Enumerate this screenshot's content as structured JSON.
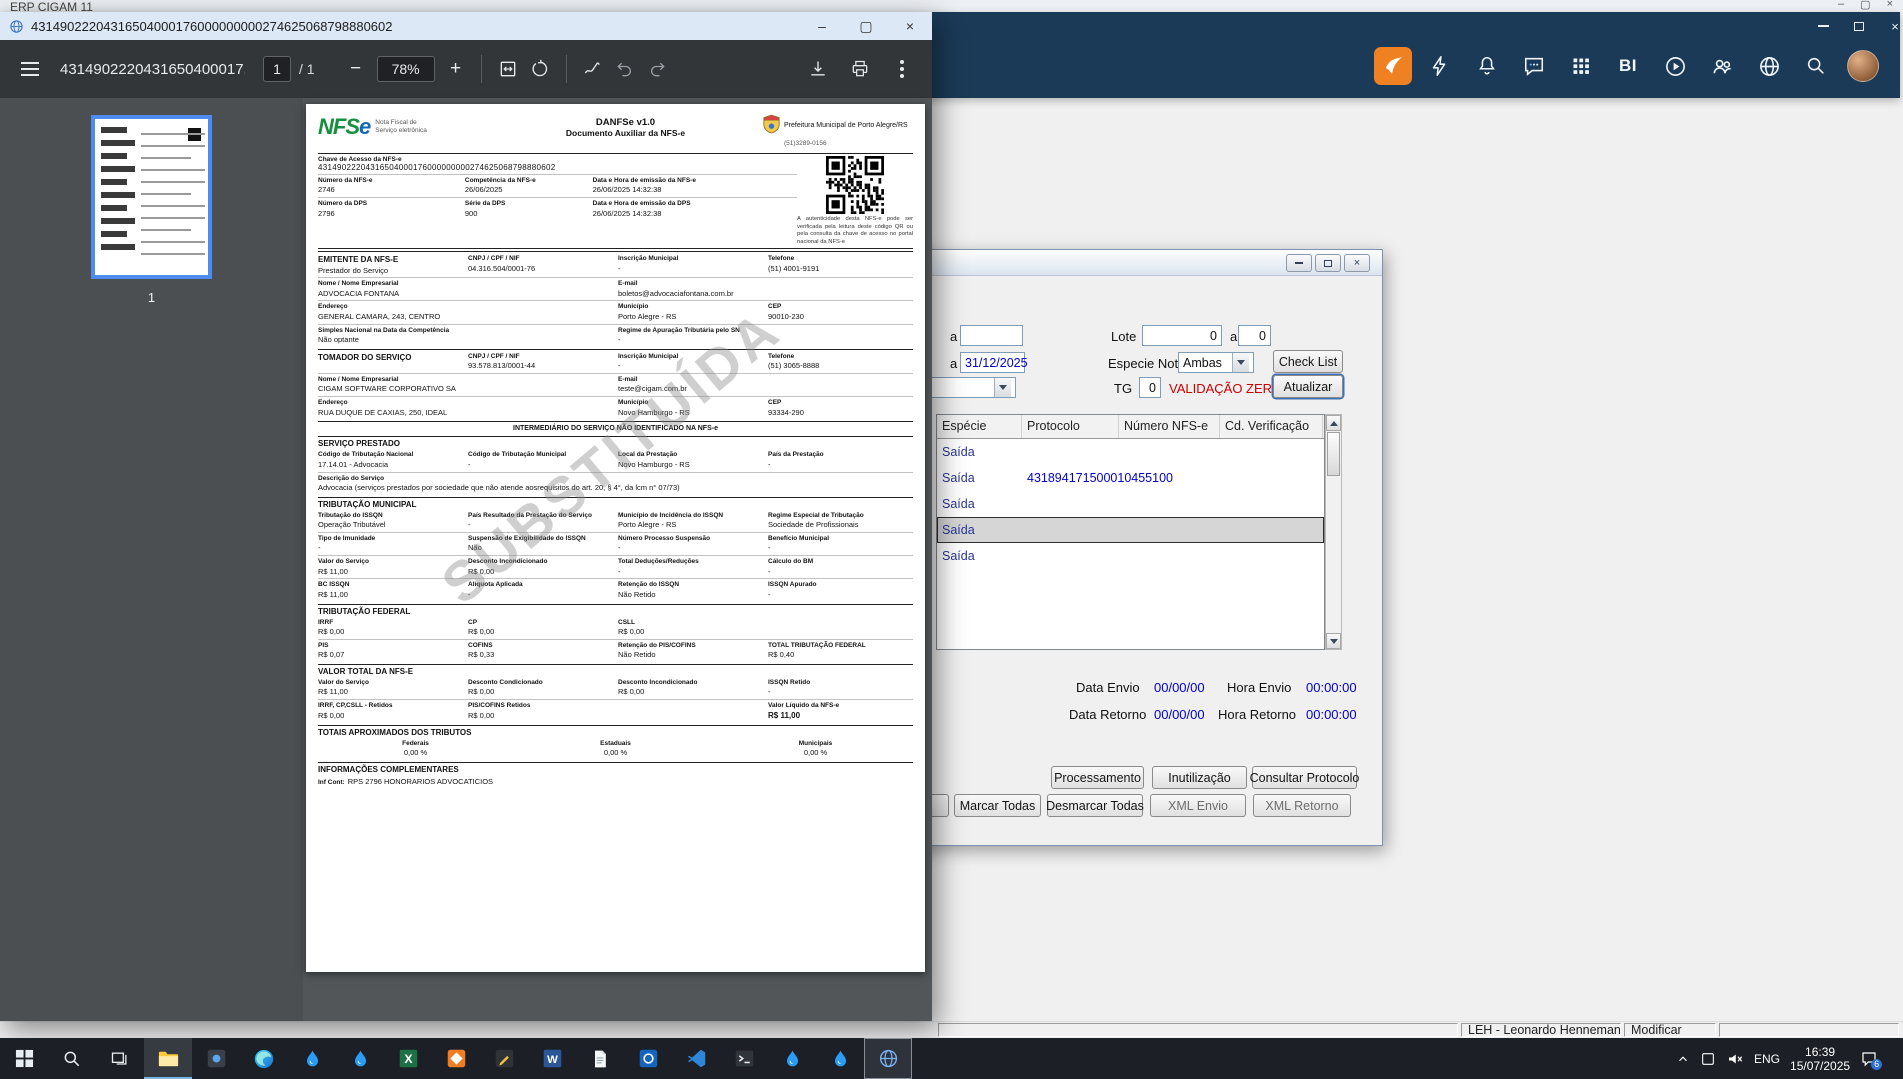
{
  "erp": {
    "title": "ERP CIGAM 11",
    "status_user": "LEH - Leonardo Hennemann",
    "status_mode": "Modificar"
  },
  "web_header": {
    "icons": [
      {
        "name": "cigam-logo-icon",
        "icon": "cigam"
      },
      {
        "name": "lightning-icon",
        "icon": "bolt"
      },
      {
        "name": "bell-icon",
        "icon": "bell"
      },
      {
        "name": "chat-icon",
        "icon": "chat"
      },
      {
        "name": "apps-grid-icon",
        "icon": "grid"
      },
      {
        "name": "bi-label",
        "text": "BI"
      },
      {
        "name": "play-icon",
        "icon": "play"
      },
      {
        "name": "people-icon",
        "icon": "people"
      },
      {
        "name": "globe-icon",
        "icon": "globeweb"
      },
      {
        "name": "search-icon",
        "icon": "searchw"
      },
      {
        "name": "user-avatar",
        "icon": "avatar"
      }
    ]
  },
  "pdf_window": {
    "title": "43149022204316504000176000000000274625068798880602",
    "toolbar": {
      "doc_title": "4314902220431650400017...",
      "page": "1",
      "page_total": "/ 1",
      "zoom": "78%"
    },
    "thumbnail_label": "1"
  },
  "doc": {
    "logo_nfs": "NFS",
    "logo_e": "e",
    "logo_sub1": "Nota Fiscal de",
    "logo_sub2": "Serviço eletrônica",
    "title": "DANFSe v1.0",
    "subtitle": "Documento Auxiliar da NFS-e",
    "city": "Prefeitura Municipal de Porto Alegre/RS",
    "city_phone": "(51)3289-0156",
    "access_key_label": "Chave de Acesso da NFS-e",
    "access_key": "43149022204316504000176000000000274625068798880602",
    "qr_caption": "A autenticidade desta NFS-e pode ser verificada pela leitura deste código QR ou pela consulta da chave de acesso no portal nacional da NFS-e",
    "watermark": "SUBSTITUÍDA",
    "meta_rows": [
      [
        {
          "l": "Número da NFS-e",
          "v": "2746"
        },
        {
          "l": "Competência da NFS-e",
          "v": "26/06/2025"
        },
        {
          "l": "Data e Hora de emissão da NFS-e",
          "v": "26/06/2025 14:32:38"
        }
      ],
      [
        {
          "l": "Número da DPS",
          "v": "2796"
        },
        {
          "l": "Série da DPS",
          "v": "900"
        },
        {
          "l": "Data e Hora de emissão da DPS",
          "v": "26/06/2025 14:32:38"
        }
      ]
    ],
    "sections": [
      {
        "rows": [
          [
            {
              "l": "EMITENTE DA NFS-E",
              "v": "Prestador do Serviço",
              "big": true
            },
            {
              "l": "CNPJ / CPF / NIF",
              "v": "04.316.504/0001-76"
            },
            {
              "l": "Inscrição Municipal",
              "v": "-"
            },
            {
              "l": "Telefone",
              "v": "(51) 4001-9191"
            }
          ],
          [
            {
              "l": "Nome / Nome Empresarial",
              "v": "ADVOCACIA FONTANA",
              "w": 6
            },
            {
              "l": "E-mail",
              "v": "boletos@advocaciafontana.com.br",
              "w": 6
            }
          ],
          [
            {
              "l": "Endereço",
              "v": "GENERAL CAMARA, 243, CENTRO",
              "w": 6
            },
            {
              "l": "Município",
              "v": "Porto Alegre - RS"
            },
            {
              "l": "CEP",
              "v": "90010-230"
            }
          ],
          [
            {
              "l": "Simples Nacional na Data da Competência",
              "v": "Não optante",
              "w": 6
            },
            {
              "l": "Regime de Apuração Tributária pelo SN",
              "v": "-",
              "w": 6
            }
          ]
        ]
      },
      {
        "rows": [
          [
            {
              "l": "TOMADOR DO SERVIÇO",
              "v": "",
              "big": true
            },
            {
              "l": "CNPJ / CPF / NIF",
              "v": "93.578.813/0001-44"
            },
            {
              "l": "Inscrição Municipal",
              "v": "-"
            },
            {
              "l": "Telefone",
              "v": "(51) 3065-8888"
            }
          ],
          [
            {
              "l": "Nome / Nome Empresarial",
              "v": "CIGAM SOFTWARE CORPORATIVO SA",
              "w": 6
            },
            {
              "l": "E-mail",
              "v": "teste@cigam.com.br",
              "w": 6
            }
          ],
          [
            {
              "l": "Endereço",
              "v": "RUA DUQUE DE CAXIAS, 250, IDEAL",
              "w": 6
            },
            {
              "l": "Município",
              "v": "Novo Hamburgo - RS"
            },
            {
              "l": "CEP",
              "v": "93334-290"
            }
          ]
        ]
      },
      {
        "note": "INTERMEDIÁRIO DO SERVIÇO NÃO IDENTIFICADO NA NFS-e"
      },
      {
        "title": "SERVIÇO PRESTADO",
        "rows": [
          [
            {
              "l": "Código de Tributação Nacional",
              "v": "17.14.01 - Advocacia"
            },
            {
              "l": "Código de Tributação Municipal",
              "v": "-"
            },
            {
              "l": "Local da Prestação",
              "v": "Novo Hamburgo - RS"
            },
            {
              "l": "País da Prestação",
              "v": "-"
            }
          ],
          [
            {
              "l": "Descrição do Serviço",
              "v": "Advocacia (serviços prestados por sociedade que não atende aosrequisitos do art. 20, § 4°, da lcm n° 07/73)",
              "w": 12
            }
          ]
        ]
      },
      {
        "title": "TRIBUTAÇÃO MUNICIPAL",
        "rows": [
          [
            {
              "l": "Tributação do ISSQN",
              "v": "Operação Tributável"
            },
            {
              "l": "País Resultado da Prestação do Serviço",
              "v": "-"
            },
            {
              "l": "Município de Incidência do ISSQN",
              "v": "Porto Alegre - RS"
            },
            {
              "l": "Regime Especial de Tributação",
              "v": "Sociedade de Profissionais"
            }
          ],
          [
            {
              "l": "Tipo de Imunidade",
              "v": "-"
            },
            {
              "l": "Suspensão de Exigibilidade do ISSQN",
              "v": "Não"
            },
            {
              "l": "Número Processo Suspensão",
              "v": "-"
            },
            {
              "l": "Benefício Municipal",
              "v": "-"
            }
          ],
          [
            {
              "l": "Valor do Serviço",
              "v": "R$ 11,00"
            },
            {
              "l": "Desconto Incondicionado",
              "v": "R$ 0,00"
            },
            {
              "l": "Total Deduções/Reduções",
              "v": "-"
            },
            {
              "l": "Cálculo do BM",
              "v": "-"
            }
          ],
          [
            {
              "l": "BC ISSQN",
              "v": "R$ 11,00"
            },
            {
              "l": "Alíquota Aplicada",
              "v": "-"
            },
            {
              "l": "Retenção do ISSQN",
              "v": "Não Retido"
            },
            {
              "l": "ISSQN Apurado",
              "v": "-"
            }
          ]
        ]
      },
      {
        "title": "TRIBUTAÇÃO FEDERAL",
        "rows": [
          [
            {
              "l": "IRRF",
              "v": "R$ 0,00"
            },
            {
              "l": "CP",
              "v": "R$ 0,00"
            },
            {
              "l": "CSLL",
              "v": "R$ 0,00"
            },
            {
              "l": "",
              "v": ""
            }
          ],
          [
            {
              "l": "PIS",
              "v": "R$ 0,07"
            },
            {
              "l": "COFINS",
              "v": "R$ 0,33"
            },
            {
              "l": "Retenção do PIS/COFINS",
              "v": "Não Retido"
            },
            {
              "l": "TOTAL TRIBUTAÇÃO FEDERAL",
              "v": "R$ 0,40"
            }
          ]
        ]
      },
      {
        "title": "VALOR TOTAL DA NFS-E",
        "rows": [
          [
            {
              "l": "Valor do Serviço",
              "v": "R$ 11,00"
            },
            {
              "l": "Desconto Condicionado",
              "v": "R$ 0,00"
            },
            {
              "l": "Desconto Incondicionado",
              "v": "R$ 0,00"
            },
            {
              "l": "ISSQN Retido",
              "v": "-"
            }
          ],
          [
            {
              "l": "IRRF, CP,CSLL - Retidos",
              "v": "R$ 0,00"
            },
            {
              "l": "PIS/COFINS Retidos",
              "v": "R$ 0,00"
            },
            {
              "l": "",
              "v": ""
            },
            {
              "l": "Valor Líquido da NFS-e",
              "v": "R$ 11,00",
              "bold_value": true
            }
          ]
        ]
      },
      {
        "title": "TOTAIS APROXIMADOS DOS TRIBUTOS",
        "rows": [
          [
            {
              "l": "Federais",
              "v": "0,00 %",
              "w": 4,
              "center": true
            },
            {
              "l": "Estaduais",
              "v": "0,00 %",
              "w": 4,
              "center": true
            },
            {
              "l": "Municipais",
              "v": "0,00 %",
              "w": 4,
              "center": true
            }
          ]
        ]
      },
      {
        "title": "INFORMAÇÕES COMPLEMENTARES",
        "rows": [
          [
            {
              "l": "Inf Cont:",
              "v": "RPS 2796 HONORARIOS ADVOCATICIOS",
              "w": 12,
              "inline": true
            }
          ]
        ]
      }
    ]
  },
  "dialog": {
    "filter": {
      "a1": "a",
      "field1": "",
      "lote_label": "Lote",
      "lote_from": "0",
      "a2": "a",
      "lote_to": "0",
      "a3": "a",
      "date_to": "31/12/2025",
      "especie_label": "Especie Nota",
      "especie_value": "Ambas",
      "check_list_label": "Check List",
      "tipo_value": "",
      "tg_label": "TG",
      "tg_value": "0",
      "warning": "VALIDAÇÃO ZERADA",
      "atualizar_label": "Atualizar"
    },
    "table": {
      "headers": [
        "Espécie",
        "Protocolo",
        "Número NFS-e",
        "Cd. Verificação"
      ],
      "rows": [
        {
          "especie": "Saída",
          "protocolo": "",
          "numero": "",
          "cd": ""
        },
        {
          "especie": "Saída",
          "protocolo": "431894171500010455100",
          "numero": "",
          "cd": ""
        },
        {
          "especie": "Saída",
          "protocolo": "",
          "numero": "",
          "cd": ""
        },
        {
          "especie": "Saída",
          "protocolo": "",
          "numero": "",
          "cd": ""
        },
        {
          "especie": "Saída",
          "protocolo": "",
          "numero": "",
          "cd": ""
        }
      ],
      "selected_index": 3
    },
    "envio": {
      "data_label": "Data Envio",
      "data": "00/00/00",
      "hora_label": "Hora Envio",
      "hora": "00:00:00"
    },
    "retorno": {
      "data_label": "Data Retorno",
      "data": "00/00/00",
      "hora_label": "Hora Retorno",
      "hora": "00:00:00"
    },
    "buttons1": [
      "Processamento",
      "Inutilização",
      "Consultar Protocolo"
    ],
    "buttons2": [
      "Marcar Todas",
      "Desmarcar Todas",
      "XML Envio",
      "XML Retorno"
    ]
  },
  "taskbar": {
    "items": [
      {
        "name": "start-button",
        "icon": "windows"
      },
      {
        "name": "search-button",
        "icon": "search"
      },
      {
        "name": "task-view-button",
        "icon": "taskview"
      },
      {
        "name": "file-explorer-button",
        "icon": "folder",
        "active": true
      },
      {
        "name": "taskbar-app-dark",
        "icon": "darkapp"
      },
      {
        "name": "taskbar-app-edge",
        "icon": "edge"
      },
      {
        "name": "taskbar-app-drop-1",
        "icon": "drop"
      },
      {
        "name": "taskbar-app-drop-2",
        "icon": "drop"
      },
      {
        "name": "taskbar-app-spreadsheet",
        "icon": "excel"
      },
      {
        "name": "taskbar-app-orange",
        "icon": "orangeapp"
      },
      {
        "name": "taskbar-app-notes",
        "icon": "darkpen"
      },
      {
        "name": "taskbar-app-word",
        "icon": "word"
      },
      {
        "name": "taskbar-app-document",
        "icon": "docfile"
      },
      {
        "name": "taskbar-app-blue",
        "icon": "blueapp"
      },
      {
        "name": "taskbar-app-vscode",
        "icon": "vscode"
      },
      {
        "name": "taskbar-app-terminal",
        "icon": "terminal"
      },
      {
        "name": "taskbar-app-drop-3",
        "icon": "drop"
      },
      {
        "name": "taskbar-app-drop-4",
        "icon": "drop"
      },
      {
        "name": "taskbar-pdf-viewer",
        "icon": "globe",
        "outlined": true
      }
    ],
    "tray": {
      "lang": "ENG",
      "time": "16:39",
      "date": "15/07/2025",
      "badge": "6"
    }
  }
}
